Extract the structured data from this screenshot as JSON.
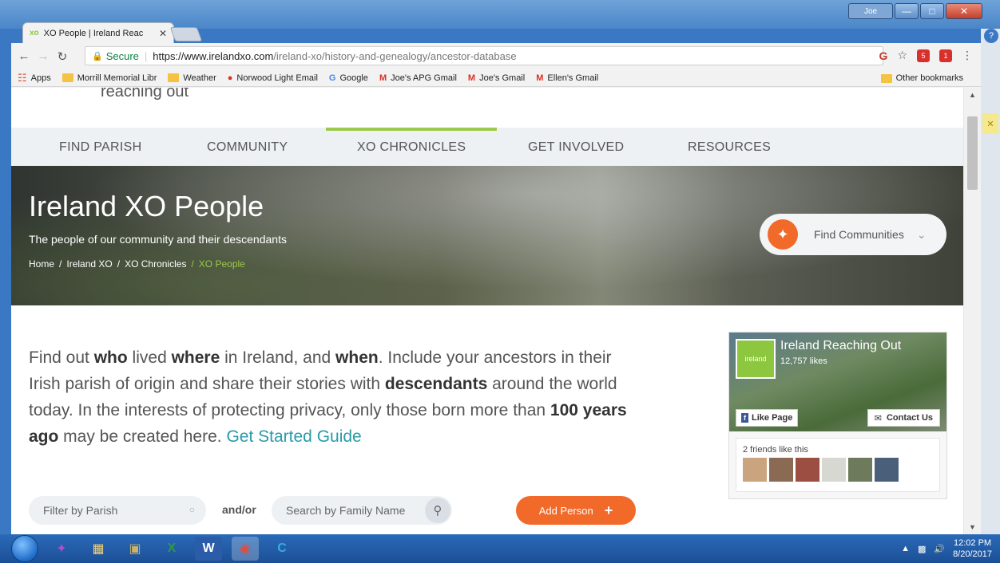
{
  "browser": {
    "tab_title": "XO People | Ireland Reac",
    "tab_favicon": "xo",
    "address": {
      "secure_label": "Secure",
      "url_host": "https://www.irelandxo.com",
      "url_path": "/ireland-xo/history-and-genealogy/ancestor-database"
    },
    "bookmarks": [
      {
        "label": "Apps",
        "icon": "apps-grid-icon"
      },
      {
        "label": "Morrill Memorial Libr",
        "icon": "folder-icon"
      },
      {
        "label": "Weather",
        "icon": "folder-icon"
      },
      {
        "label": "Norwood Light Email",
        "icon": "norwood-light-icon"
      },
      {
        "label": "Google",
        "icon": "google-icon"
      },
      {
        "label": "Joe's APG Gmail",
        "icon": "gmail-icon"
      },
      {
        "label": "Joe's Gmail",
        "icon": "gmail-icon"
      },
      {
        "label": "Ellen's Gmail",
        "icon": "gmail-icon"
      }
    ],
    "other_bookmarks": "Other bookmarks",
    "ext_badges": [
      "5",
      "1"
    ]
  },
  "window": {
    "user_label": "Joe"
  },
  "site": {
    "logo_tagline": "reaching out",
    "nav": [
      {
        "label": "FIND PARISH"
      },
      {
        "label": "COMMUNITY"
      },
      {
        "label": "XO CHRONICLES",
        "active": true
      },
      {
        "label": "GET INVOLVED"
      },
      {
        "label": "RESOURCES"
      }
    ],
    "accent_color": "#9bc94b",
    "cta_color": "#f26a2a"
  },
  "hero": {
    "title": "Ireland XO People",
    "subtitle": "The people of our community and their descendants",
    "breadcrumbs": [
      "Home",
      "Ireland XO",
      "XO Chronicles"
    ],
    "breadcrumb_current": "XO People",
    "find_communities": "Find Communities"
  },
  "intro": {
    "p1": "Find out ",
    "b1": "who",
    "p2": " lived ",
    "b2": "where",
    "p3": " in Ireland, and ",
    "b3": "when",
    "p4": ". Include your ancestors in their Irish parish of origin and share their stories with ",
    "b4": "descendants",
    "p5": " around the world today. In the interests of protecting privacy, only those born more than ",
    "b5": "100 years ago",
    "p6": " may be created here. ",
    "link": "Get Started Guide"
  },
  "facebook": {
    "page_name": "Ireland Reaching Out",
    "likes": "12,757 likes",
    "logo_text": "ireland",
    "like_button": "Like Page",
    "contact_button": "Contact Us",
    "friends_text": "2 friends like this"
  },
  "filters": {
    "parish_placeholder": "Filter by Parish",
    "andor": "and/or",
    "family_placeholder": "Search by Family Name",
    "add_person": "Add Person"
  },
  "taskbar": {
    "time": "12:02 PM",
    "date": "8/20/2017"
  }
}
